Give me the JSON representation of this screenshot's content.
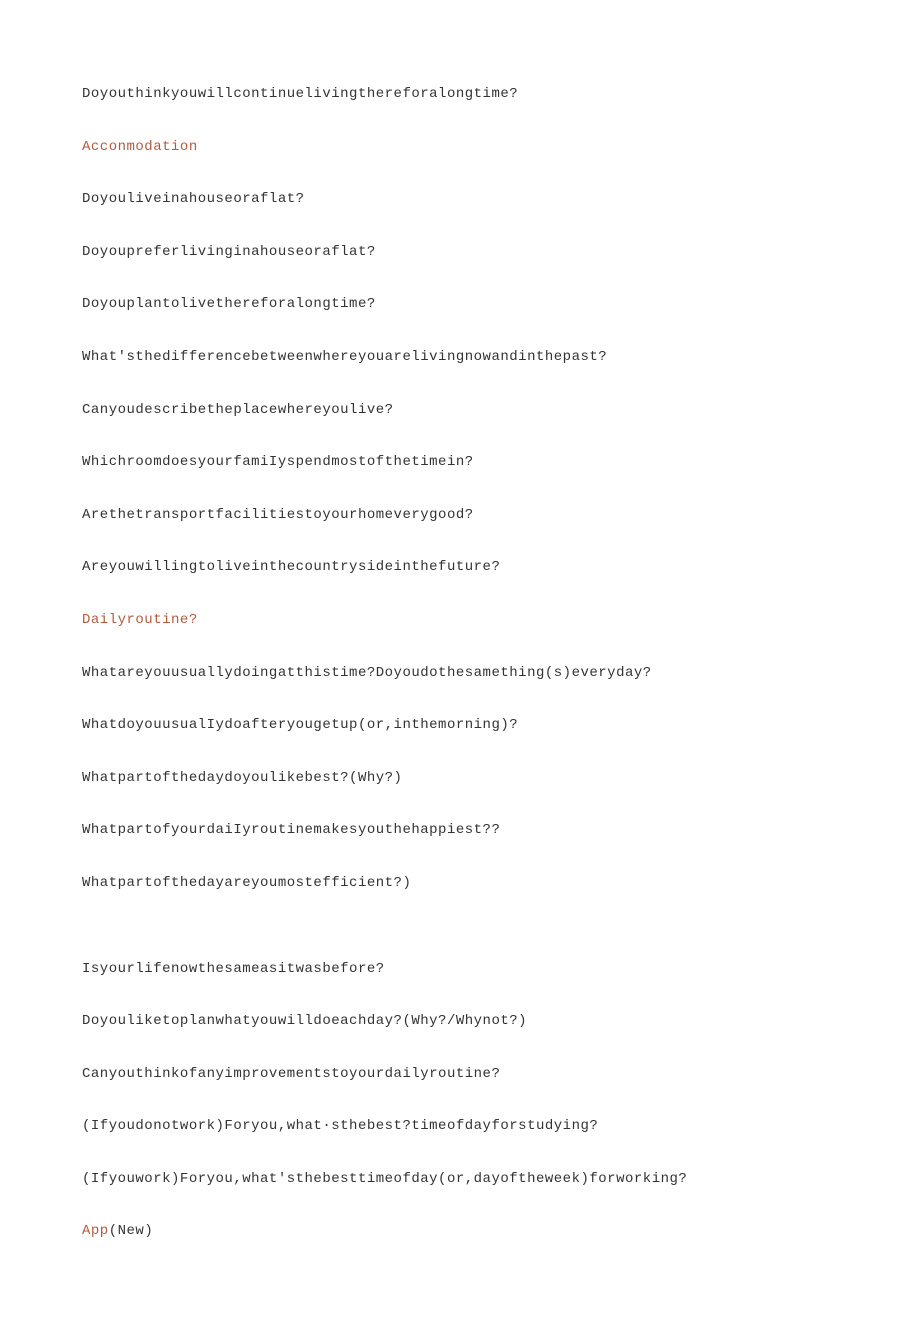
{
  "lines": [
    {
      "type": "text",
      "content": "Doyouthinkyouwillcontinuelivingthereforalongtime?"
    },
    {
      "type": "heading",
      "content": "Acconmodation"
    },
    {
      "type": "text",
      "content": "Doyouliveinahouseoraflat?"
    },
    {
      "type": "text",
      "content": "Doyoupreferlivinginahouseoraflat?"
    },
    {
      "type": "text",
      "content": "Doyouplantolivethereforalongtime?"
    },
    {
      "type": "text",
      "content": "What'sthedifferencebetweenwhereyouarelivingnowandinthepast?"
    },
    {
      "type": "text",
      "content": "Canyoudescribetheplacewhereyoulive?"
    },
    {
      "type": "text",
      "content": "WhichroomdoesyourfamiIyspendmostofthetimein?"
    },
    {
      "type": "text",
      "content": "Arethetransportfacilitiestoyourhomeverygood?"
    },
    {
      "type": "text",
      "content": "Areyouwillingtoliveinthecountrysideinthefuture?"
    },
    {
      "type": "heading",
      "content": "Dailyroutine?"
    },
    {
      "type": "text",
      "content": "Whatareyouusuallydoingatthistime?Doyoudothesamething(s)everyday?"
    },
    {
      "type": "text",
      "content": "WhatdoyouusualIydoafteryougetup(or,inthemorning)?"
    },
    {
      "type": "text",
      "content": "Whatpartofthedaydoyoulikebest?(Why?)"
    },
    {
      "type": "text",
      "content": "WhatpartofyourdaiIyroutinemakesyouthehappiest??"
    },
    {
      "type": "text",
      "content": "Whatpartofthedayareyoumostefficient?)"
    },
    {
      "type": "spacer",
      "content": ""
    },
    {
      "type": "text",
      "content": "Isyourlifenowthesameasitwasbefore?"
    },
    {
      "type": "text",
      "content": "Doyouliketoplanwhatyouwilldoeachday?(Why?/Whynot?)"
    },
    {
      "type": "text",
      "content": "Canyouthinkofanyimprovementstoyourdailyroutine?"
    },
    {
      "type": "text",
      "content": "(Ifyoudonotwork)Foryou,what·sthebest?timeofdayforstudying?"
    },
    {
      "type": "text",
      "content": "(Ifyouwork)Foryou,what'sthebesttimeofday(or,dayoftheweek)forworking?"
    },
    {
      "type": "mixed",
      "red": "App",
      "black": "(New)"
    }
  ]
}
